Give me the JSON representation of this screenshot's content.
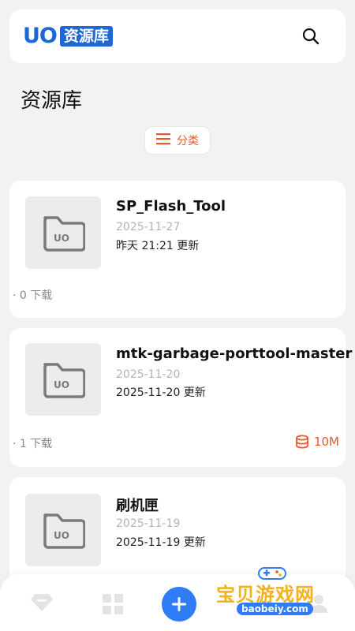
{
  "header": {
    "logo_mark": "UO",
    "logo_text": "资源库",
    "search_icon": "search-icon"
  },
  "page": {
    "title": "资源库",
    "category_button": "分类"
  },
  "resources": [
    {
      "title": "SP_Flash_Tool",
      "date": "2025-11-27",
      "updated": "昨天 21:21 更新",
      "downloads": "· 0  下载",
      "size": ""
    },
    {
      "title": "mtk-garbage-porttool-master",
      "date": "2025-11-20",
      "updated": "2025-11-20 更新",
      "downloads": "· 1  下载",
      "size": "10M"
    },
    {
      "title": "刷机匣",
      "date": "2025-11-19",
      "updated": "2025-11-19 更新",
      "downloads": "",
      "size": ""
    }
  ],
  "bottom_nav": {
    "items": [
      "diamond-icon",
      "grid-icon",
      "add-icon",
      "profile-icon"
    ]
  },
  "watermark": {
    "text": "宝贝游戏网",
    "url": "baobeiy.com"
  },
  "colors": {
    "accent": "#e9572b",
    "brand": "#1f66d6",
    "fab": "#2f7cf6"
  }
}
